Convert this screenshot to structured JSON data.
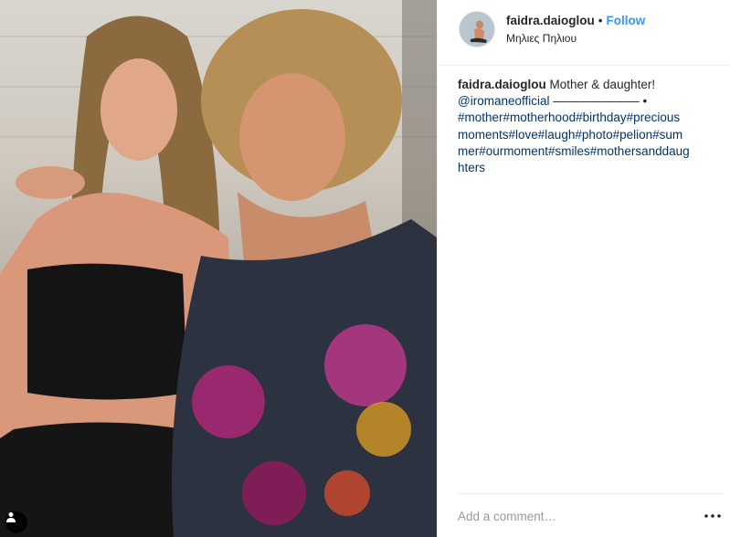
{
  "post": {
    "photo_alt": "Mother & daughter",
    "tag_icon": "user-tag-icon"
  },
  "header": {
    "username": "faidra.daioglou",
    "separator": "•",
    "follow_label": "Follow",
    "location": "Μηλιες Πηλιου",
    "avatar_icon": "avatar"
  },
  "caption": {
    "username": "faidra.daioglou",
    "text": "Mother & daughter!",
    "mention": "@iromaneofficial",
    "dashes": "——————— •",
    "hashtags_lines": [
      "#mother#motherhood#birthday#precious",
      "moments#love#laugh#photo#pelion#sum",
      "mer#ourmoment#smiles#mothersanddaug",
      "hters"
    ]
  },
  "footer": {
    "comment_placeholder": "Add a comment…",
    "more_icon": "more-options-icon"
  },
  "colors": {
    "link": "#3897f0",
    "hashtag": "#003569",
    "text": "#262626",
    "border": "#efefef"
  }
}
